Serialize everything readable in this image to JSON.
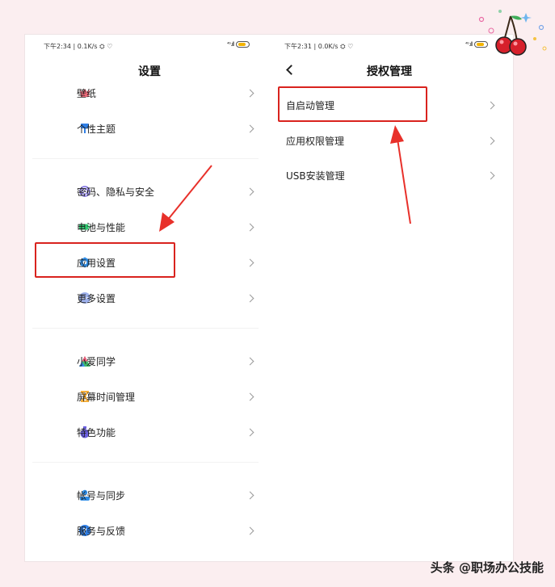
{
  "left_screen": {
    "status_time": "下午2:34 | 0.1K/s ⛭ ♡",
    "title": "设置",
    "items": [
      {
        "label": "壁纸",
        "icon": "wallpaper-icon",
        "color": "#f06a7a"
      },
      {
        "label": "个性主题",
        "icon": "theme-brush-icon",
        "color": "#2f7fe6"
      },
      {
        "label": "密码、隐私与安全",
        "icon": "fingerprint-icon",
        "color": "#7d6ee6"
      },
      {
        "label": "电池与性能",
        "icon": "battery-icon",
        "color": "#2ecc71"
      },
      {
        "label": "应用设置",
        "icon": "gear-icon",
        "color": "#2f8de6"
      },
      {
        "label": "更多设置",
        "icon": "more-dots-icon",
        "color": "#7a96e8"
      },
      {
        "label": "小爱同学",
        "icon": "xiaoai-icon",
        "color": "#3fb96b"
      },
      {
        "label": "屏幕时间管理",
        "icon": "hourglass-icon",
        "color": "#f5a623"
      },
      {
        "label": "特色功能",
        "icon": "special-feature-icon",
        "color": "#6a5fe0"
      },
      {
        "label": "帐号与同步",
        "icon": "account-icon",
        "color": "#2f8de6"
      },
      {
        "label": "服务与反馈",
        "icon": "help-icon",
        "color": "#2f7fe6"
      }
    ]
  },
  "right_screen": {
    "status_time": "下午2:31 | 0.0K/s ⛭ ♡",
    "title": "授权管理",
    "items": [
      {
        "label": "自启动管理"
      },
      {
        "label": "应用权限管理"
      },
      {
        "label": "USB安装管理"
      }
    ]
  },
  "signal_text": "⁴ᴳ.ıll",
  "accent_color": "#d9231e",
  "watermark": "头条 @职场办公技能"
}
